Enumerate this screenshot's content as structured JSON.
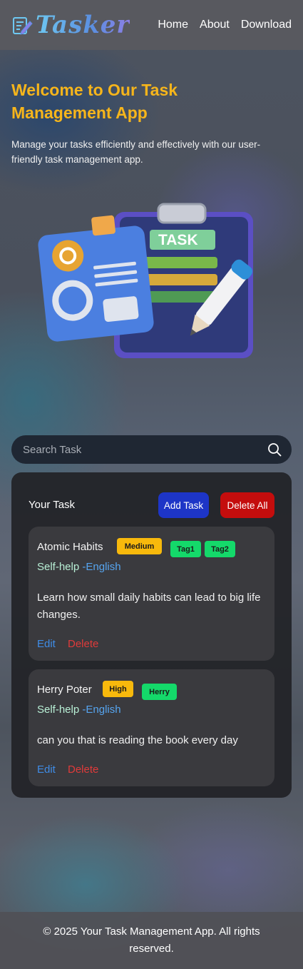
{
  "header": {
    "logo_text": "Tasker",
    "logo_icon": "notepad-pencil-icon",
    "nav": [
      {
        "label": "Home"
      },
      {
        "label": "About"
      },
      {
        "label": "Download"
      }
    ]
  },
  "hero": {
    "title": "Welcome to Our Task Management App",
    "description": "Manage your tasks efficiently and effectively with our user-friendly task management app.",
    "illustration_label": "TASK"
  },
  "search": {
    "placeholder": "Search Task",
    "icon": "search-icon"
  },
  "panel": {
    "title": "Your Task",
    "add_label": "Add Task",
    "delete_all_label": "Delete All",
    "tasks": [
      {
        "title": "Atomic Habits",
        "priority": "Medium",
        "tags": [
          "Tag1",
          "Tag2"
        ],
        "category": "Self-help",
        "separator": "-",
        "language": "English",
        "description": "Learn how small daily habits can lead to big life changes.",
        "edit_label": "Edit",
        "delete_label": "Delete"
      },
      {
        "title": "Herry Poter",
        "priority": "High",
        "tags": [
          "Herry"
        ],
        "category": "Self-help",
        "separator": "-",
        "language": "English",
        "description": "can you that is reading the book every day",
        "edit_label": "Edit",
        "delete_label": "Delete"
      }
    ]
  },
  "footer": {
    "text": "© 2025 Your Task Management App. All rights reserved."
  },
  "colors": {
    "accent_yellow": "#f6b51b",
    "add_button": "#1d35c7",
    "delete_button": "#c40d0d",
    "tag_green": "#14d96a",
    "priority_yellow": "#f8b90c"
  }
}
